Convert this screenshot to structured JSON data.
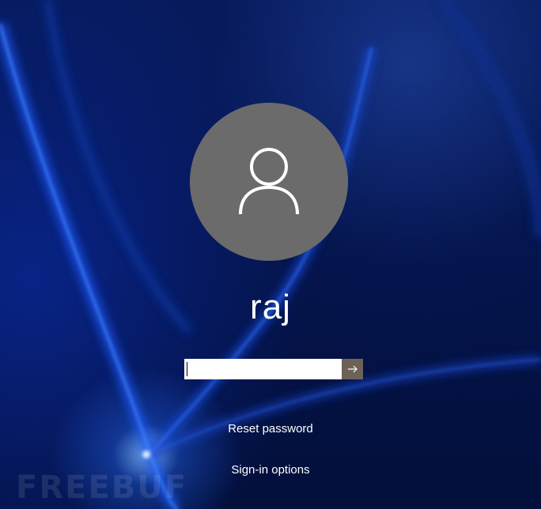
{
  "user": {
    "name": "raj",
    "avatar_icon": "user-silhouette-icon"
  },
  "password": {
    "value": "",
    "placeholder": "",
    "submit_icon": "arrow-right-icon"
  },
  "links": {
    "reset_password": "Reset password",
    "sign_in_options": "Sign-in options"
  },
  "watermark": "FREEBUF",
  "colors": {
    "background": "#03103a",
    "avatar_circle": "#6b6b6b",
    "submit_button": "#6d6258",
    "text": "#ffffff"
  }
}
